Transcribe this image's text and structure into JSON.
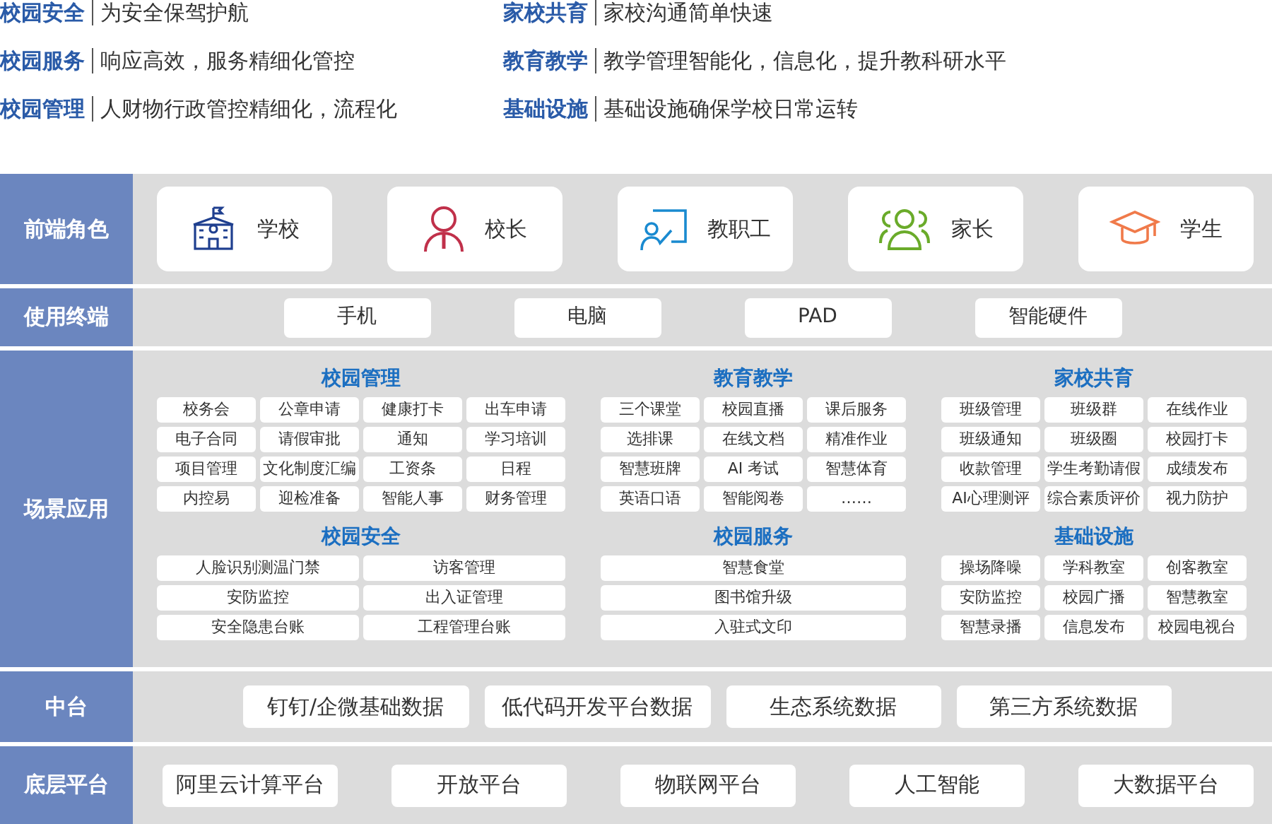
{
  "intro": [
    {
      "title": "校园安全",
      "desc": "为安全保驾护航"
    },
    {
      "title": "家校共育",
      "desc": "家校沟通简单快速"
    },
    {
      "title": "校园服务",
      "desc": "响应高效，服务精细化管控"
    },
    {
      "title": "教育教学",
      "desc": "教学管理智能化，信息化，提升教科研水平"
    },
    {
      "title": "校园管理",
      "desc": "人财物行政管控精细化，流程化"
    },
    {
      "title": "基础设施",
      "desc": "基础设施确保学校日常运转"
    }
  ],
  "layers": [
    {
      "kind": "roles",
      "label": "前端角色",
      "items": [
        "学校",
        "校长",
        "教职工",
        "家长",
        "学生"
      ]
    },
    {
      "kind": "terminals",
      "label": "使用终端",
      "items": [
        "手机",
        "电脑",
        "PAD",
        "智能硬件"
      ]
    },
    {
      "kind": "scenes",
      "label": "场景应用",
      "columns": [
        [
          {
            "title": "校园管理",
            "rows": [
              [
                "校务会",
                "公章申请",
                "健康打卡",
                "出车申请"
              ],
              [
                "电子合同",
                "请假审批",
                "通知",
                "学习培训"
              ],
              [
                "项目管理",
                "文化制度汇编",
                "工资条",
                "日程"
              ],
              [
                "内控易",
                "迎检准备",
                "智能人事",
                "财务管理"
              ]
            ]
          },
          {
            "title": "校园安全",
            "rows": [
              [
                "人脸识别测温门禁",
                "访客管理"
              ],
              [
                "安防监控",
                "出入证管理"
              ],
              [
                "安全隐患台账",
                "工程管理台账"
              ]
            ]
          }
        ],
        [
          {
            "title": "教育教学",
            "rows": [
              [
                "三个课堂",
                "校园直播",
                "课后服务"
              ],
              [
                "选排课",
                "在线文档",
                "精准作业"
              ],
              [
                "智慧班牌",
                "AI 考试",
                "智慧体育"
              ],
              [
                "英语口语",
                "智能阅卷",
                "……"
              ]
            ]
          },
          {
            "title": "校园服务",
            "rows": [
              [
                "智慧食堂"
              ],
              [
                "图书馆升级"
              ],
              [
                "入驻式文印"
              ]
            ]
          }
        ],
        [
          {
            "title": "家校共育",
            "rows": [
              [
                "班级管理",
                "班级群",
                "在线作业"
              ],
              [
                "班级通知",
                "班级圈",
                "校园打卡"
              ],
              [
                "收款管理",
                "学生考勤请假",
                "成绩发布"
              ],
              [
                "AI心理测评",
                "综合素质评价",
                "视力防护"
              ]
            ]
          },
          {
            "title": "基础设施",
            "rows": [
              [
                "操场降噪",
                "学科教室",
                "创客教室"
              ],
              [
                "安防监控",
                "校园广播",
                "智慧教室"
              ],
              [
                "智慧录播",
                "信息发布",
                "校园电视台"
              ]
            ]
          }
        ]
      ]
    },
    {
      "kind": "middle",
      "label": "中台",
      "items": [
        "钉钉/企微基础数据",
        "低代码开发平台数据",
        "生态系统数据",
        "第三方系统数据"
      ]
    },
    {
      "kind": "base",
      "label": "底层平台",
      "items": [
        "阿里云计算平台",
        "开放平台",
        "物联网平台",
        "人工智能",
        "大数据平台"
      ]
    }
  ]
}
